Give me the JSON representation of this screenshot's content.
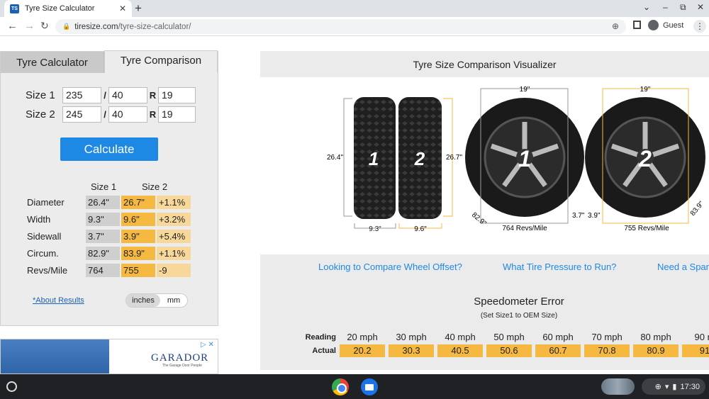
{
  "browser": {
    "tab_title": "Tyre Size Calculator",
    "favicon_text": "TS",
    "url_host": "tiresize.com",
    "url_path": "/tyre-size-calculator/",
    "profile": "Guest"
  },
  "calculator": {
    "tab_calc": "Tyre Calculator",
    "tab_compare": "Tyre Comparison",
    "size1": {
      "label": "Size 1",
      "width": "235",
      "ratio": "40",
      "rim": "19"
    },
    "size2": {
      "label": "Size 2",
      "width": "245",
      "ratio": "40",
      "rim": "19"
    },
    "sep_slash": "/",
    "sep_r": "R",
    "calculate": "Calculate",
    "col_size1": "Size 1",
    "col_size2": "Size 2",
    "rows": [
      {
        "label": "Diameter",
        "s1": "26.4\"",
        "s2": "26.7\"",
        "diff": "+1.1%"
      },
      {
        "label": "Width",
        "s1": "9.3\"",
        "s2": "9.6\"",
        "diff": "+3.2%"
      },
      {
        "label": "Sidewall",
        "s1": "3.7\"",
        "s2": "3.9\"",
        "diff": "+5.4%"
      },
      {
        "label": "Circum.",
        "s1": "82.9\"",
        "s2": "83.9\"",
        "diff": "+1.1%"
      },
      {
        "label": "Revs/Mile",
        "s1": "764",
        "s2": "755",
        "diff": "-9"
      }
    ],
    "about": "*About Results",
    "unit_inches": "inches",
    "unit_mm": "mm"
  },
  "ad": {
    "brand": "GARADOR",
    "tagline": "The Garage Door People",
    "ad_choices": "▷ ✕"
  },
  "visualizer": {
    "title": "Tyre Size Comparison Visualizer",
    "tyre1": {
      "num": "1",
      "height": "26.4\"",
      "width": "9.3\"",
      "rim": "19\"",
      "sidewall": "3.7\"",
      "circum": "82.9\"",
      "revs": "764 Revs/Mile"
    },
    "tyre2": {
      "num": "2",
      "height": "26.7\"",
      "width": "9.6\"",
      "rim": "19\"",
      "sidewall": "3.9\"",
      "circum": "83.9\"",
      "revs": "755 Revs/Mile"
    },
    "links": [
      "Looking to Compare Wheel Offset?",
      "What Tire Pressure to Run?",
      "Need a Spar"
    ]
  },
  "speedometer": {
    "title": "Speedometer Error",
    "subtitle": "(Set Size1 to OEM Size)",
    "reading_label": "Reading",
    "actual_label": "Actual",
    "readings": [
      "20 mph",
      "30 mph",
      "40 mph",
      "50 mph",
      "60 mph",
      "70 mph",
      "80 mph",
      "90 m"
    ],
    "actuals": [
      "20.2",
      "30.3",
      "40.5",
      "50.6",
      "60.7",
      "70.8",
      "80.9",
      "91"
    ]
  },
  "taskbar": {
    "time": "17:30"
  },
  "colors": {
    "accent_blue": "#1e88e5",
    "size2_orange": "#f5b942",
    "size1_gray": "#cfcfcf"
  }
}
